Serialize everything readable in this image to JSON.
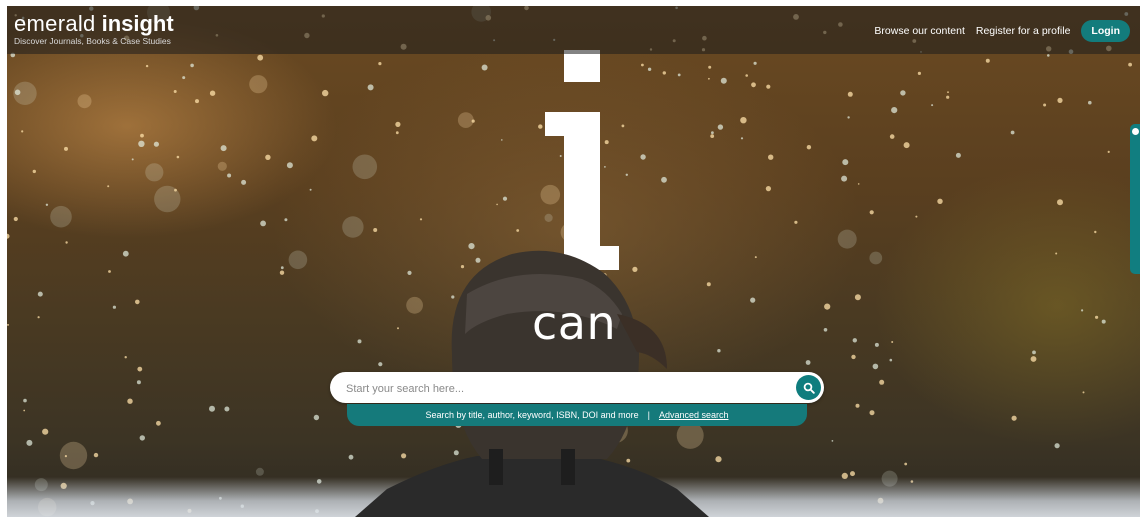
{
  "header": {
    "logo_word1": "emerald",
    "logo_word2": "insight",
    "tagline": "Discover Journals, Books & Case Studies",
    "nav": {
      "browse": "Browse our content",
      "register": "Register for a profile",
      "login": "Login"
    }
  },
  "hero": {
    "big_letter": "i",
    "word": "can"
  },
  "search": {
    "placeholder": "Start your search here...",
    "help_text": "Search by title, author, keyword, ISBN, DOI and more",
    "separator": "|",
    "advanced_link": "Advanced search"
  },
  "colors": {
    "accent": "#137c7c",
    "text_on_dark": "#ffffff"
  },
  "icons": {
    "search_button": "search-icon",
    "side_tab": "feedback-tab"
  }
}
